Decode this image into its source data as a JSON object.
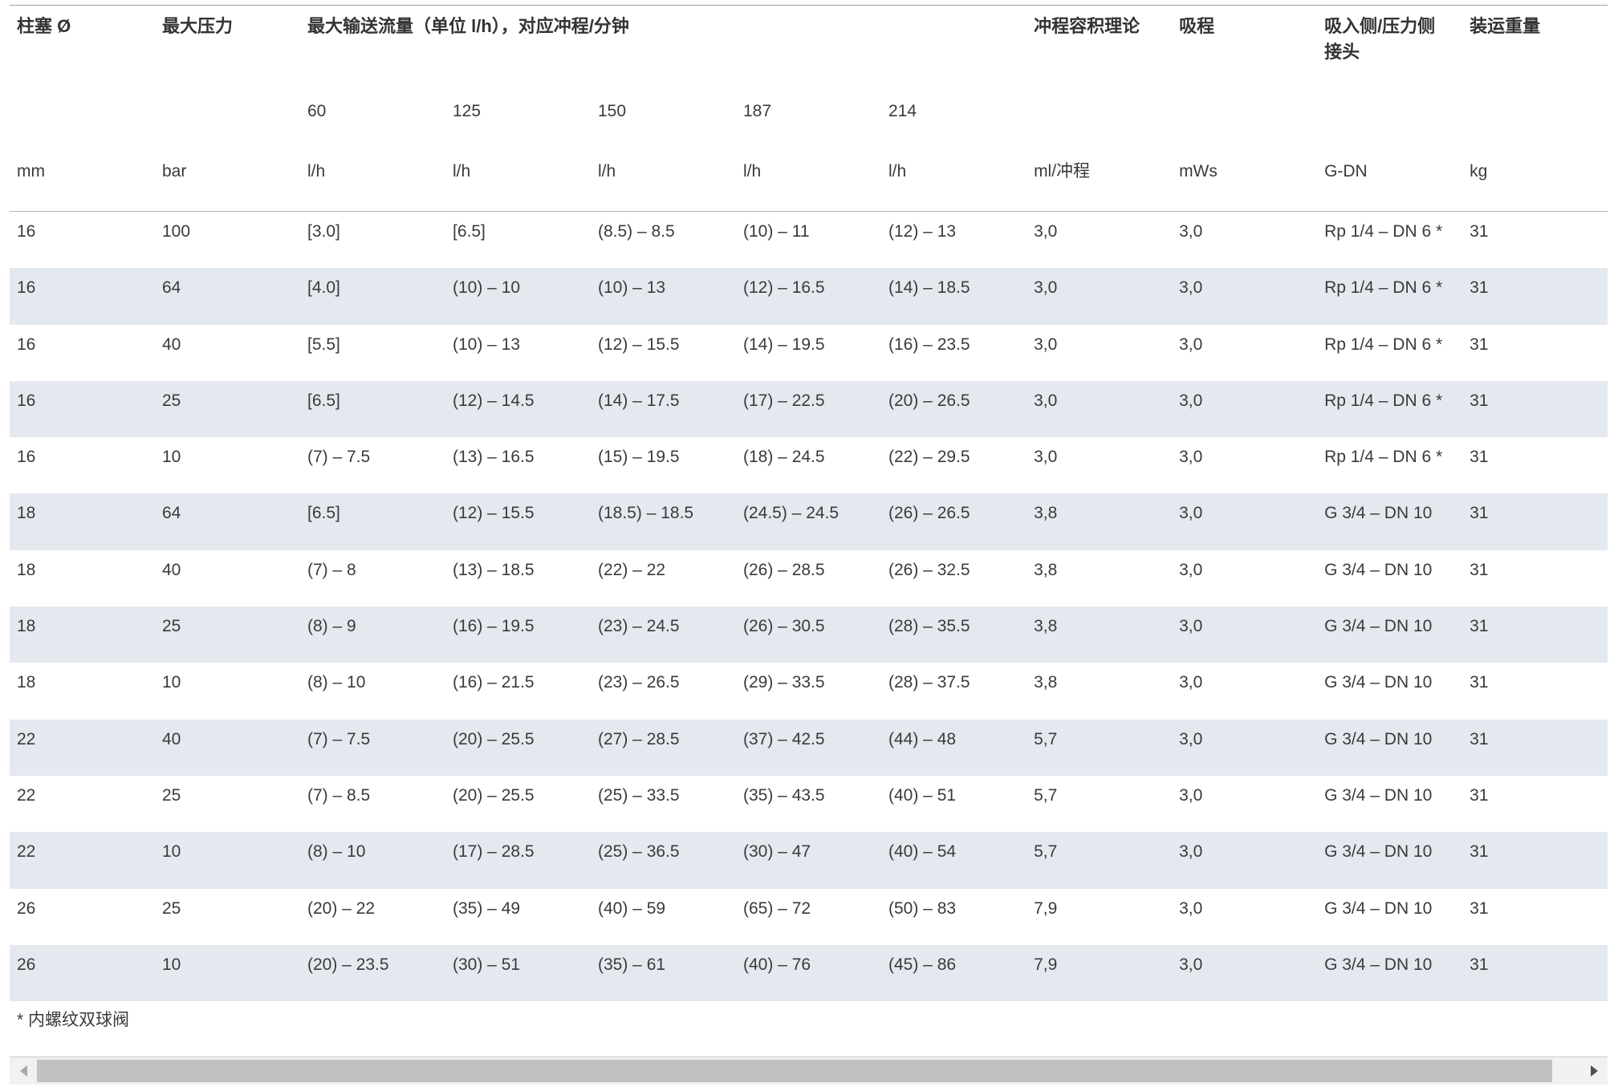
{
  "table": {
    "header": {
      "plunger": "柱塞 Ø",
      "max_pressure": "最大压力",
      "max_flow": "最大输送流量（单位 l/h），对应冲程/分钟",
      "stroke_volume": "冲程容积理论",
      "suction_lift": "吸程",
      "connection": "吸入侧/压力侧接头",
      "shipping_weight": "装运重量"
    },
    "strokes_per_minute": [
      "60",
      "125",
      "150",
      "187",
      "214"
    ],
    "units": [
      "mm",
      "bar",
      "l/h",
      "l/h",
      "l/h",
      "l/h",
      "l/h",
      "ml/冲程",
      "mWs",
      "G-DN",
      "kg"
    ],
    "rows": [
      [
        "16",
        "100",
        "[3.0]",
        "[6.5]",
        "(8.5) – 8.5",
        "(10) – 11",
        "(12) – 13",
        "3,0",
        "3,0",
        "Rp 1/4 – DN 6 *",
        "31"
      ],
      [
        "16",
        "64",
        "[4.0]",
        "(10) – 10",
        "(10) – 13",
        "(12) – 16.5",
        "(14) – 18.5",
        "3,0",
        "3,0",
        "Rp 1/4 – DN 6 *",
        "31"
      ],
      [
        "16",
        "40",
        "[5.5]",
        "(10) – 13",
        "(12) – 15.5",
        "(14) – 19.5",
        "(16) – 23.5",
        "3,0",
        "3,0",
        "Rp 1/4 – DN 6 *",
        "31"
      ],
      [
        "16",
        "25",
        "[6.5]",
        "(12) – 14.5",
        "(14) – 17.5",
        "(17) – 22.5",
        "(20) – 26.5",
        "3,0",
        "3,0",
        "Rp 1/4 – DN 6 *",
        "31"
      ],
      [
        "16",
        "10",
        "(7) – 7.5",
        "(13) – 16.5",
        "(15) – 19.5",
        "(18) – 24.5",
        "(22) – 29.5",
        "3,0",
        "3,0",
        "Rp 1/4 – DN 6 *",
        "31"
      ],
      [
        "18",
        "64",
        "[6.5]",
        "(12) – 15.5",
        "(18.5) – 18.5",
        "(24.5) – 24.5",
        "(26) – 26.5",
        "3,8",
        "3,0",
        "G 3/4 – DN 10",
        "31"
      ],
      [
        "18",
        "40",
        "(7) – 8",
        "(13) – 18.5",
        "(22) – 22",
        "(26) – 28.5",
        "(26) – 32.5",
        "3,8",
        "3,0",
        "G 3/4 – DN 10",
        "31"
      ],
      [
        "18",
        "25",
        "(8) – 9",
        "(16) – 19.5",
        "(23) – 24.5",
        "(26) – 30.5",
        "(28) – 35.5",
        "3,8",
        "3,0",
        "G 3/4 – DN 10",
        "31"
      ],
      [
        "18",
        "10",
        "(8) – 10",
        "(16) – 21.5",
        "(23) – 26.5",
        "(29) – 33.5",
        "(28) – 37.5",
        "3,8",
        "3,0",
        "G 3/4 – DN 10",
        "31"
      ],
      [
        "22",
        "40",
        "(7) – 7.5",
        "(20) – 25.5",
        "(27) – 28.5",
        "(37) – 42.5",
        "(44) – 48",
        "5,7",
        "3,0",
        "G 3/4 – DN 10",
        "31"
      ],
      [
        "22",
        "25",
        "(7) – 8.5",
        "(20) – 25.5",
        "(25) – 33.5",
        "(35) – 43.5",
        "(40) – 51",
        "5,7",
        "3,0",
        "G 3/4 – DN 10",
        "31"
      ],
      [
        "22",
        "10",
        "(8) – 10",
        "(17) – 28.5",
        "(25) – 36.5",
        "(30) – 47",
        "(40) – 54",
        "5,7",
        "3,0",
        "G 3/4 – DN 10",
        "31"
      ],
      [
        "26",
        "25",
        "(20) – 22",
        "(35) – 49",
        "(40) – 59",
        "(65) – 72",
        "(50) – 83",
        "7,9",
        "3,0",
        "G 3/4 – DN 10",
        "31"
      ],
      [
        "26",
        "10",
        "(20) – 23.5",
        "(30) – 51",
        "(35) – 61",
        "(40) – 76",
        "(45) – 86",
        "7,9",
        "3,0",
        "G 3/4 – DN 10",
        "31"
      ]
    ]
  },
  "footnote": "* 内螺纹双球阀",
  "scrollbar": {
    "left_icon": "triangle-left-icon",
    "right_icon": "triangle-right-icon",
    "scroll_fraction": 0,
    "visible_fraction": 0.982
  },
  "colors": {
    "stripe_row": "#e4e8ef",
    "text": "#3a3a3a"
  }
}
